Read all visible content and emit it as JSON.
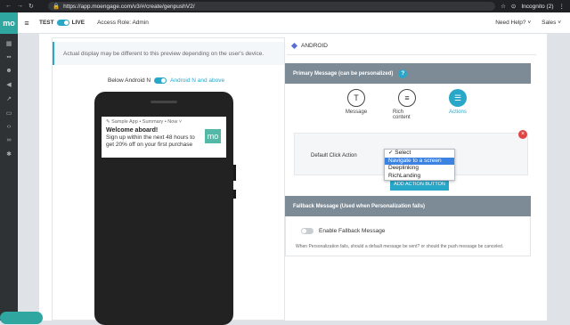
{
  "browser": {
    "url": "https://app.moengage.com/v3/#/create/genpushV2/",
    "profile": "Incognito (2)"
  },
  "appbar": {
    "logo": "mo",
    "env_left": "TEST",
    "env_right": "LIVE",
    "access_role": "Access Role: Admin",
    "help": "Need Help?",
    "account": "Sales"
  },
  "sidebar": {
    "icons": [
      "grid-icon",
      "apps-icon",
      "users-icon",
      "megaphone-icon",
      "chart-icon",
      "cart-icon",
      "code-icon",
      "link-icon",
      "gear-icon"
    ]
  },
  "preview": {
    "notice": "Actual display may be different to this preview depending on the user's device.",
    "toggle_left": "Below Android N",
    "toggle_right": "Android N and above",
    "notification": {
      "meta": "✎ Sample App • Summary • Now ˅",
      "title": "Welcome aboard!",
      "body": "Sign up within the next 48 hours to get 20% off on your first purchase",
      "badge": "mo"
    }
  },
  "editor": {
    "tab": "ANDROID",
    "primary_header": "Primary Message (can be personalized)",
    "help_glyph": "?",
    "message_types": [
      {
        "label": "Message",
        "glyph": "T",
        "active": false
      },
      {
        "label": "Rich content",
        "glyph": "≡",
        "active": false
      },
      {
        "label": "Actions",
        "glyph": "☰",
        "active": true
      }
    ],
    "default_click_action_label": "Default Click Action",
    "dropdown_options": [
      "Select",
      "Navigate to a screen",
      "Deeplinking",
      "RichLanding"
    ],
    "dropdown_selected": "Select",
    "dropdown_highlighted": "Navigate to a screen",
    "add_action_button": "ADD ACTION BUTTON",
    "fallback_header": "Fallback Message (Used when Personalization fails)",
    "fallback_toggle_label": "Enable Fallback Message",
    "fallback_note": "When Personalization fails, should a default message be sent? or should the push message be canceled."
  },
  "colors": {
    "brand": "#2fa7a0",
    "accent": "#29a7c9",
    "header_bg": "#7d8b96",
    "danger": "#e04545"
  }
}
